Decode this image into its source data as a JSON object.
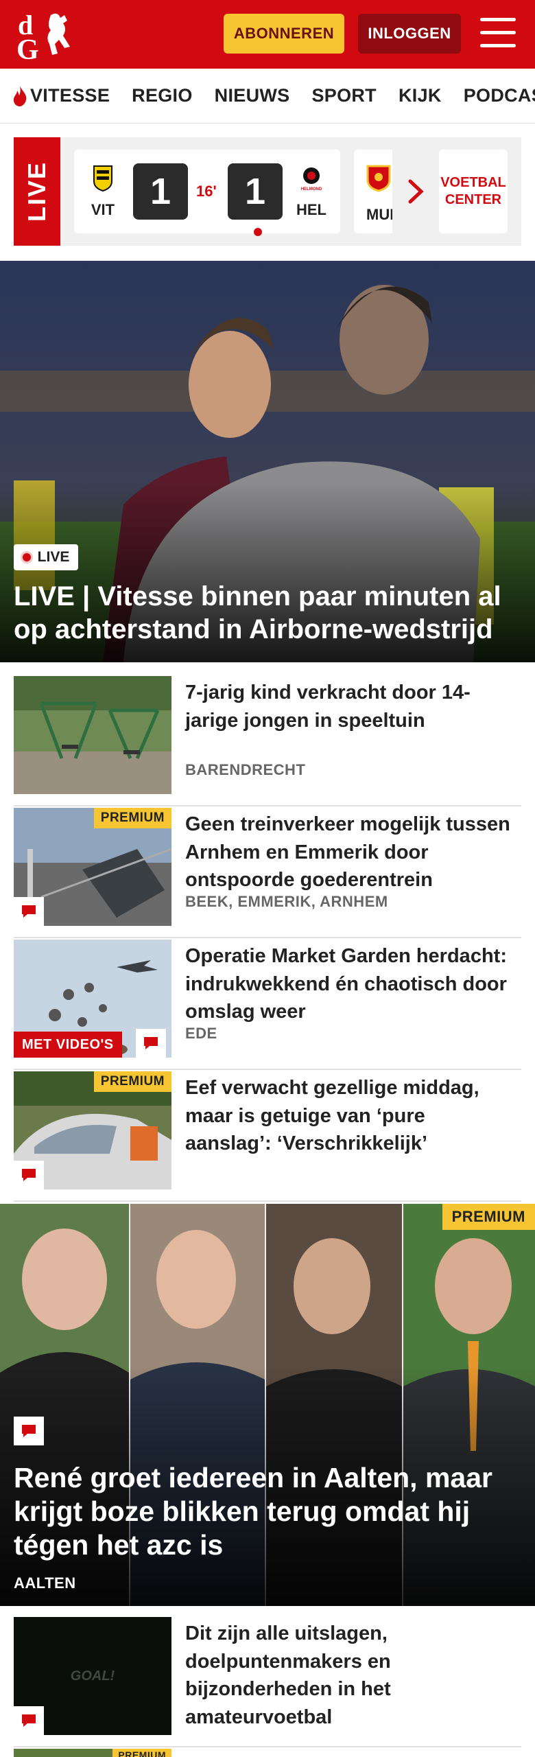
{
  "header": {
    "logo_text": "dG",
    "subscribe_label": "ABONNEREN",
    "login_label": "INLOGGEN",
    "menu_icon": "hamburger-icon",
    "brand_red": "#d10a11",
    "accent_yellow": "#f7c531"
  },
  "nav": {
    "items": [
      {
        "label": "VITESSE",
        "icon": "flame-icon"
      },
      {
        "label": "REGIO"
      },
      {
        "label": "NIEUWS"
      },
      {
        "label": "SPORT"
      },
      {
        "label": "KIJK"
      },
      {
        "label": "PODCAST"
      }
    ]
  },
  "live": {
    "tag": "LIVE",
    "match": {
      "home": "VIT",
      "away": "HEL",
      "home_score": "1",
      "away_score": "1",
      "minute": "16'"
    },
    "next_match_home": "MUI",
    "football_center": "VOETBAL CENTER"
  },
  "hero": {
    "badge": "LIVE",
    "title": "LIVE | Vitesse binnen paar minuten al op achterstand in Airborne-wedstrijd"
  },
  "articles": [
    {
      "title": "7-jarig kind verkracht door 14-jarige jongen in speeltuin",
      "location": "BARENDRECHT"
    },
    {
      "title": "Geen treinverkeer mogelijk tussen Arnhem en Emmerik door ontspoorde goederentrein",
      "location": "BEEK, EMMERIK, ARNHEM",
      "premium": "PREMIUM"
    },
    {
      "title": "Operatie Market Garden herdacht: indrukwekkend én chaotisch door omslag weer",
      "location": "EDE",
      "video": "MET VIDEO'S"
    },
    {
      "title": "Eef verwacht gezellige middag, maar is getuige van ‘pure aanslag’: ‘Verschrikkelijk’",
      "premium": "PREMIUM"
    }
  ],
  "big_article": {
    "title": "René groet iedereen in Aalten, maar krijgt boze blikken terug omdat hij tégen het azc is",
    "location": "AALTEN",
    "premium": "PREMIUM"
  },
  "last_article": {
    "title": "Dit zijn alle uitslagen, doelpuntenmakers en bijzonderheden in het amateurvoetbal",
    "thumb_text": "GOAL!"
  },
  "peek_article": {
    "premium": "PREMIUM"
  }
}
